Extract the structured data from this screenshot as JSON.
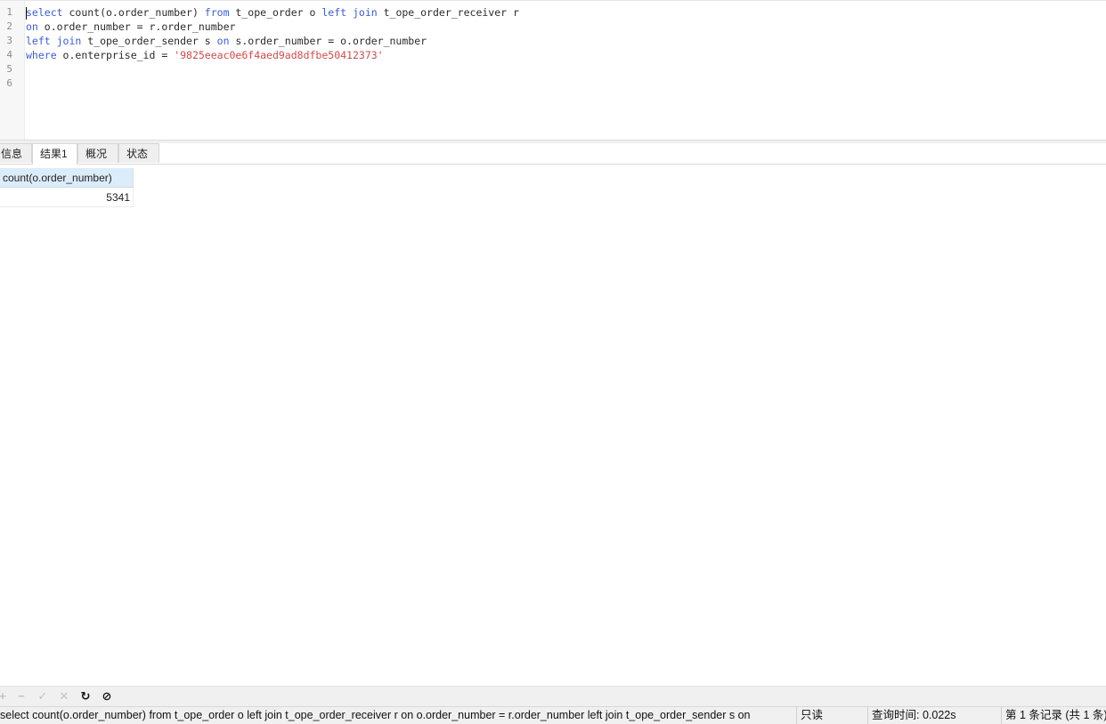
{
  "editor": {
    "line_numbers": [
      "1",
      "2",
      "3",
      "4",
      "5",
      "6"
    ],
    "lines": [
      [
        {
          "t": "select",
          "k": "kw"
        },
        {
          "t": " count(o.order_number) ",
          "k": ""
        },
        {
          "t": "from",
          "k": "kw"
        },
        {
          "t": " t_ope_order o ",
          "k": ""
        },
        {
          "t": "left join",
          "k": "kw"
        },
        {
          "t": " t_ope_order_receiver r",
          "k": ""
        }
      ],
      [
        {
          "t": "on",
          "k": "kw"
        },
        {
          "t": " o.order_number = r.order_number",
          "k": ""
        }
      ],
      [
        {
          "t": "left join",
          "k": "kw"
        },
        {
          "t": " t_ope_order_sender s ",
          "k": ""
        },
        {
          "t": "on",
          "k": "kw"
        },
        {
          "t": " s.order_number = o.order_number",
          "k": ""
        }
      ],
      [
        {
          "t": "where",
          "k": "kw"
        },
        {
          "t": " o.enterprise_id = ",
          "k": ""
        },
        {
          "t": "'9825eeac0e6f4aed9ad8dfbe50412373'",
          "k": "str"
        }
      ],
      [],
      []
    ]
  },
  "tabs": {
    "info": "信息",
    "result1": "结果1",
    "profile": "概况",
    "status": "状态"
  },
  "result": {
    "column": "count(o.order_number)",
    "value": "5341"
  },
  "toolbar": {
    "add": "+",
    "remove": "−",
    "apply": "✓",
    "discard": "✕",
    "refresh": "↻",
    "stop": "⊘"
  },
  "statusbar": {
    "sql": "select count(o.order_number) from t_ope_order o left join t_ope_order_receiver r  on o.order_number = r.order_number left join t_ope_order_sender s on",
    "mode": "只读",
    "query_time": "查询时间: 0.022s",
    "records": "第 1 条记录 (共 1 条)"
  },
  "colors": {
    "keyword": "#3b5cdc",
    "string": "#d24a4a",
    "header_bg": "#dcecf9"
  }
}
